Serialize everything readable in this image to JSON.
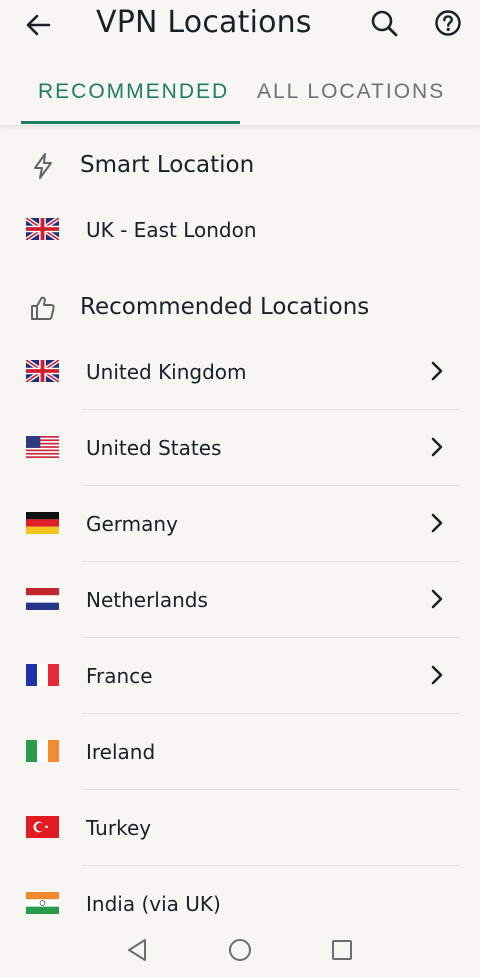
{
  "header": {
    "title": "VPN Locations",
    "back_icon": "arrow-left-icon",
    "search_icon": "search-icon",
    "help_icon": "help-circle-icon"
  },
  "tabs": [
    {
      "label": "RECOMMENDED",
      "active": true
    },
    {
      "label": "ALL LOCATIONS",
      "active": false
    }
  ],
  "colors": {
    "accent": "#1e7d63",
    "background": "#f7f6f2",
    "text": "#17212a",
    "inactive_tab": "#6b7175"
  },
  "smart": {
    "heading": "Smart Location",
    "icon": "lightning-bolt-icon",
    "location": {
      "name": "UK - East London",
      "flag": "uk-flag"
    }
  },
  "recommended": {
    "heading": "Recommended Locations",
    "icon": "thumbs-up-icon",
    "items": [
      {
        "name": "United Kingdom",
        "flag": "uk-flag",
        "has_chevron": true
      },
      {
        "name": "United States",
        "flag": "us-flag",
        "has_chevron": true
      },
      {
        "name": "Germany",
        "flag": "germany-flag",
        "has_chevron": true
      },
      {
        "name": "Netherlands",
        "flag": "netherlands-flag",
        "has_chevron": true
      },
      {
        "name": "France",
        "flag": "france-flag",
        "has_chevron": true
      },
      {
        "name": "Ireland",
        "flag": "ireland-flag",
        "has_chevron": false
      },
      {
        "name": "Turkey",
        "flag": "turkey-flag",
        "has_chevron": false
      },
      {
        "name": "India (via UK)",
        "flag": "india-flag",
        "has_chevron": false
      }
    ]
  },
  "navbar": {
    "back": "triangle-back-icon",
    "home": "circle-home-icon",
    "recents": "square-recents-icon"
  }
}
